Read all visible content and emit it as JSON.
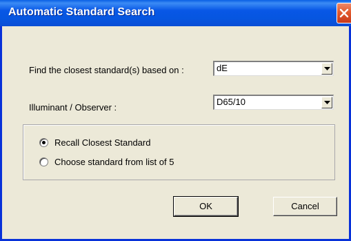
{
  "window": {
    "title": "Automatic Standard Search"
  },
  "form": {
    "find_label": "Find the closest standard(s) based on  :",
    "find_value": "dE",
    "illuminant_label": "Illuminant / Observer :",
    "illuminant_value": "D65/10"
  },
  "options": {
    "items": [
      {
        "label": "Recall Closest Standard",
        "selected": true
      },
      {
        "label": "Choose standard from list of 5",
        "selected": false
      }
    ]
  },
  "buttons": {
    "ok_label": "OK",
    "cancel_label": "Cancel"
  },
  "colors": {
    "titlebar": "#0857e6",
    "close": "#e25a2e",
    "dialog_bg": "#ece9d8"
  },
  "icons": {
    "close": "close-icon",
    "dropdown": "chevron-down-icon"
  }
}
